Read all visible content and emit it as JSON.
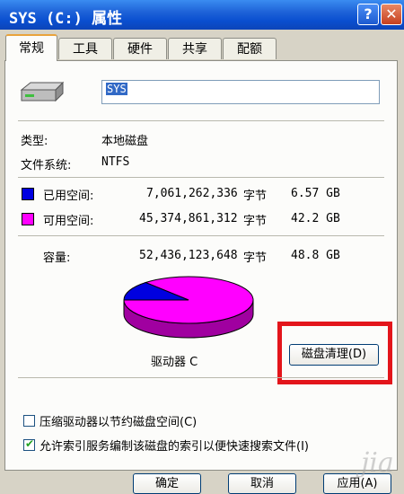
{
  "window": {
    "title": "SYS (C:) 属性",
    "help_label": "?",
    "close_label": "✕"
  },
  "tabs": [
    {
      "label": "常规",
      "active": true
    },
    {
      "label": "工具",
      "active": false
    },
    {
      "label": "硬件",
      "active": false
    },
    {
      "label": "共享",
      "active": false
    },
    {
      "label": "配额",
      "active": false
    }
  ],
  "general": {
    "drive_name": "SYS",
    "type_label": "类型:",
    "type_value": "本地磁盘",
    "fs_label": "文件系统:",
    "fs_value": "NTFS"
  },
  "space": {
    "used": {
      "label": "已用空间:",
      "bytes": "7,061,262,336",
      "unit": "字节",
      "size": "6.57 GB",
      "color": "#0000e0"
    },
    "free": {
      "label": "可用空间:",
      "bytes": "45,374,861,312",
      "unit": "字节",
      "size": "42.2 GB",
      "color": "#ff00ff"
    },
    "capacity": {
      "label": "容量:",
      "bytes": "52,436,123,648",
      "unit": "字节",
      "size": "48.8 GB"
    },
    "used_fraction": 0.1347
  },
  "drive_label": "驱动器 C",
  "cleanup_button": "磁盘清理(D)",
  "options": {
    "compress": {
      "label": "压缩驱动器以节约磁盘空间(C)",
      "checked": false
    },
    "index": {
      "label": "允许索引服务编制该磁盘的索引以便快速搜索文件(I)",
      "checked": true
    }
  },
  "buttons": {
    "ok": "确定",
    "cancel": "取消",
    "apply": "应用(A)"
  }
}
